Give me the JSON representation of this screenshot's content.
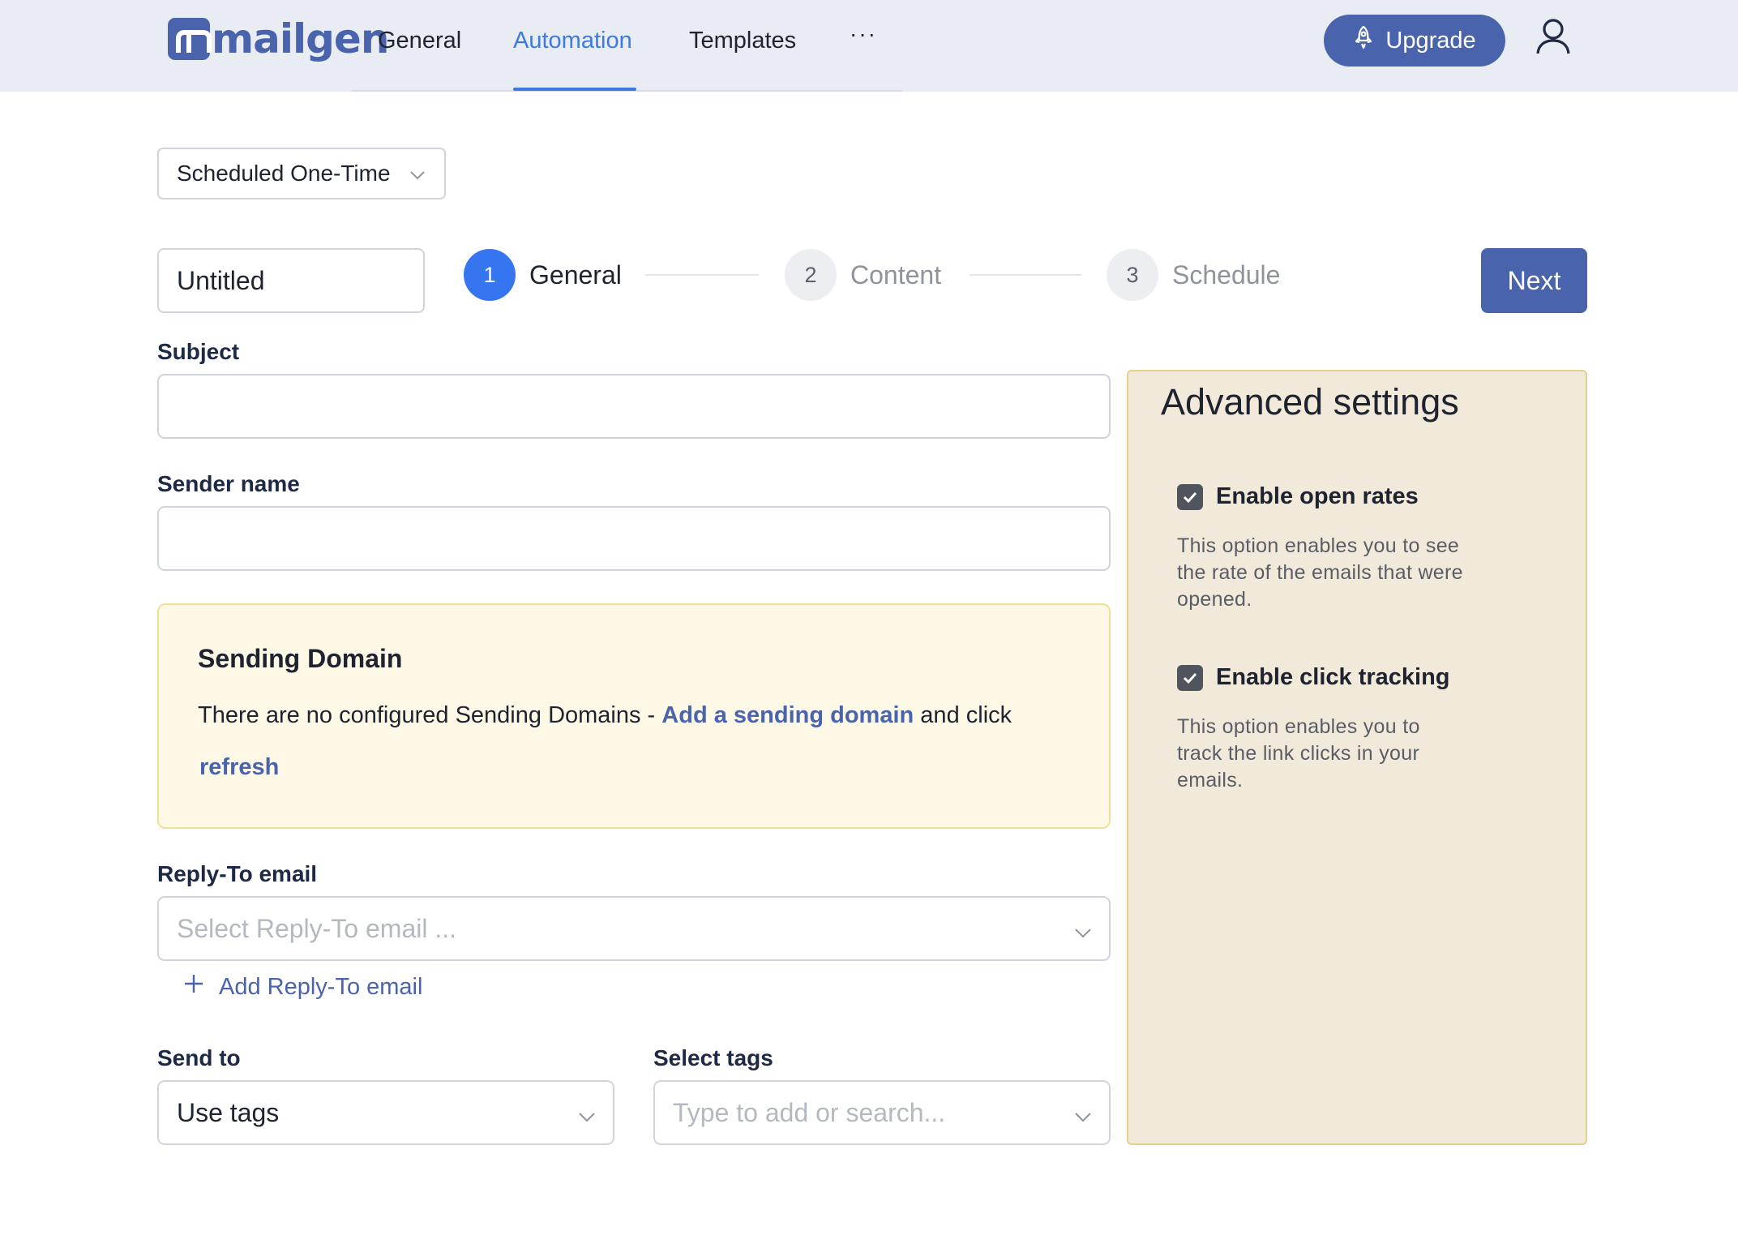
{
  "header": {
    "logo_text": "mailgen",
    "nav": [
      {
        "label": "General",
        "active": false
      },
      {
        "label": "Automation",
        "active": true
      },
      {
        "label": "Templates",
        "active": false
      }
    ],
    "more_label": "···",
    "upgrade_label": "Upgrade"
  },
  "campaign": {
    "type_value": "Scheduled One-Time",
    "name_value": "Untitled",
    "steps": [
      {
        "number": "1",
        "label": "General",
        "active": true
      },
      {
        "number": "2",
        "label": "Content",
        "active": false
      },
      {
        "number": "3",
        "label": "Schedule",
        "active": false
      }
    ],
    "next_label": "Next"
  },
  "form": {
    "subject_label": "Subject",
    "subject_value": "",
    "sender_label": "Sender name",
    "sender_value": "",
    "sending_domain": {
      "title": "Sending Domain",
      "text_before": "There are no configured Sending Domains - ",
      "link_label": "Add a sending domain",
      "text_after": " and click",
      "refresh_label": "refresh"
    },
    "reply_to_label": "Reply-To email",
    "reply_to_placeholder": "Select Reply-To email ...",
    "add_reply_to_label": "Add Reply-To email",
    "send_to_label": "Send to",
    "send_to_value": "Use tags",
    "tags_label": "Select tags",
    "tags_placeholder": "Type to add or search..."
  },
  "advanced": {
    "title": "Advanced settings",
    "options": [
      {
        "label": "Enable open rates",
        "checked": true,
        "description": "This option enables you to see the rate of the emails that were opened."
      },
      {
        "label": "Enable click tracking",
        "checked": true,
        "description": "This option enables you to track the link clicks in your emails."
      }
    ]
  },
  "colors": {
    "brand": "#4a63ad",
    "accent": "#3d7be0",
    "step_active": "#3576f0",
    "notice_bg": "#fdf9e6",
    "panel_bg": "#f1eada"
  }
}
